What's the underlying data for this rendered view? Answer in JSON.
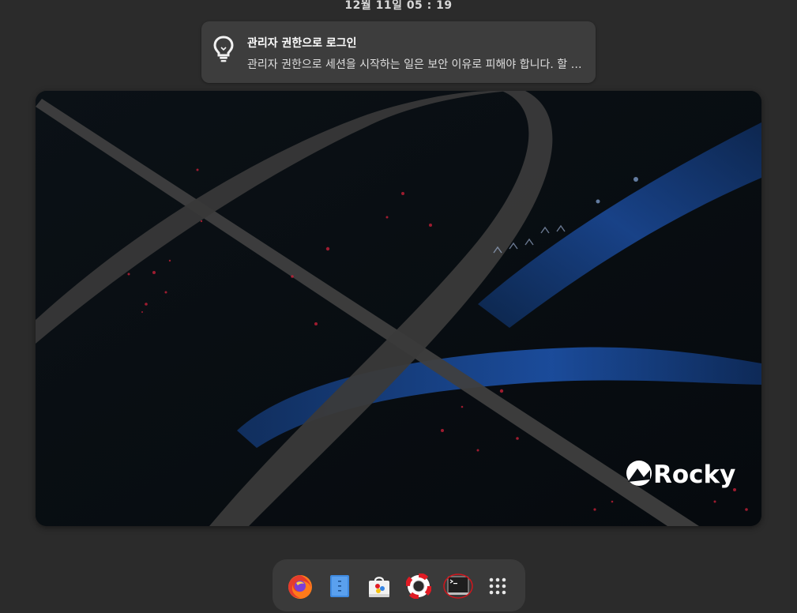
{
  "top_bar": {
    "clock": "12월 11일  05 : 19"
  },
  "notification": {
    "icon": "lightbulb-icon",
    "title": "관리자 권한으로 로그인",
    "body": "관리자 권한으로 세션을 시작하는 일은 보안 이유로 피해야 합니다. 할 …"
  },
  "workspace": {
    "wallpaper_logo_text": "Rocky"
  },
  "dock": {
    "apps": [
      {
        "name": "Firefox",
        "icon": "firefox-icon"
      },
      {
        "name": "Files",
        "icon": "files-icon"
      },
      {
        "name": "Software",
        "icon": "software-icon"
      },
      {
        "name": "Help",
        "icon": "help-icon"
      },
      {
        "name": "Terminal",
        "icon": "terminal-icon"
      },
      {
        "name": "Show Applications",
        "icon": "app-grid-icon"
      }
    ]
  },
  "colors": {
    "background": "#2b2b2b",
    "notification_bg": "#3d3d3d",
    "dock_bg": "#3a3a3a",
    "accent_red": "#e01b24",
    "wallpaper_blue": "#1d4fa8"
  }
}
